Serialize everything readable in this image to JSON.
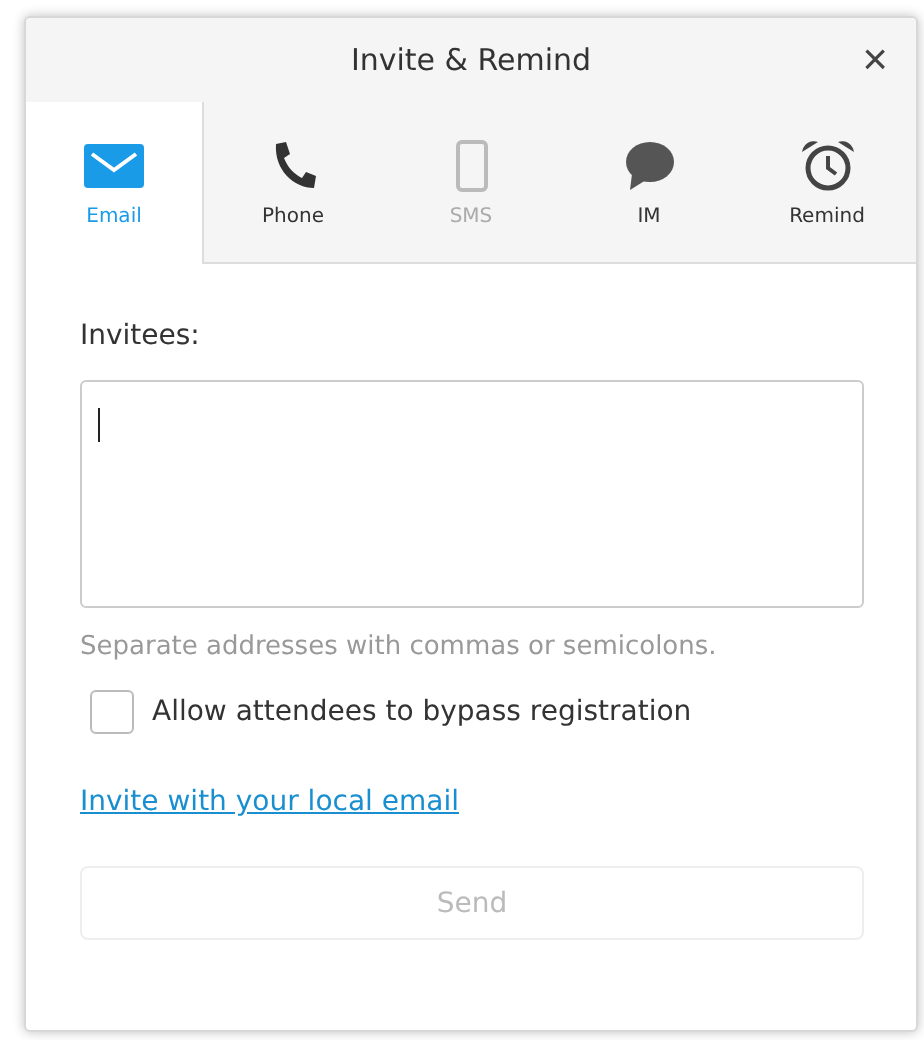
{
  "window": {
    "title": "Invite & Remind",
    "close": "×"
  },
  "tabs": [
    {
      "kind": "email",
      "label": "Email",
      "selected": true,
      "disabled": false
    },
    {
      "kind": "phone",
      "label": "Phone",
      "selected": false,
      "disabled": false
    },
    {
      "kind": "sms",
      "label": "SMS",
      "selected": false,
      "disabled": true
    },
    {
      "kind": "im",
      "label": "IM",
      "selected": false,
      "disabled": false
    },
    {
      "kind": "remind",
      "label": "Remind",
      "selected": false,
      "disabled": false
    }
  ],
  "invitees": {
    "label": "Invitees:",
    "focused": true,
    "hint": "Separate addresses with commas or semicolons."
  },
  "bypass": {
    "label": "Allow attendees to bypass registration",
    "checked": false
  },
  "link": "Invite with your local email",
  "send": {
    "label": "Send",
    "disabled": true
  }
}
